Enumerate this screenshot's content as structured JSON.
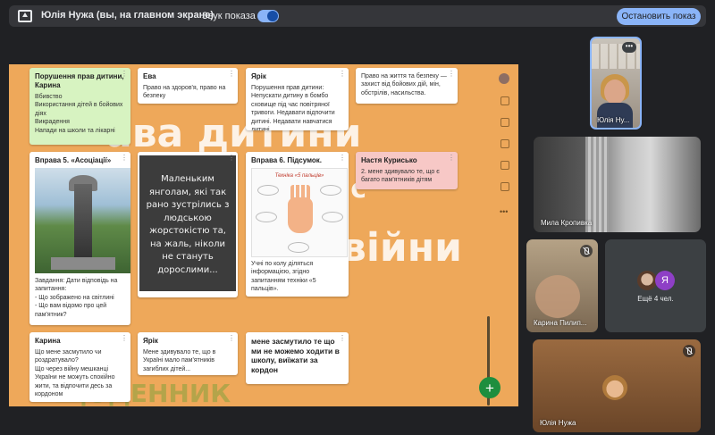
{
  "topbar": {
    "title": "Юлія Нужа (вы, на главном экране)",
    "sound_label": "Звук показа",
    "sound_on": true,
    "stop_button": "Остановить показ"
  },
  "presentation": {
    "bg_text_1": "ава дитини",
    "bg_text_2": "ас",
    "bg_text_3": "війни",
    "bg_text_4": "ЩОДЕННИК",
    "cards": {
      "c1": {
        "title": "Порушення прав дитини, Карина",
        "text": "Вбивство\nВикористання дітей в бойових діях\nВикрадення\nНапади на школи та лікарні"
      },
      "c2": {
        "title": "Ева",
        "text": "Право на здоров'я, право на безпеку"
      },
      "c3": {
        "title": "Ярік",
        "text": "Порушення прав дитини:\nНепускати дитину в бомбо сховище під час повітряної тривоги. Недавати відпочити дитині. Недавати навчатися дитині..."
      },
      "c4": {
        "text": "Право на життя та безпеку — захист від бойових дій, мін, обстрілів, насильства."
      },
      "c5": {
        "title": "Вправа 5. «Асоціації»",
        "text": "Завдання: Дати відповідь на запитання:\n-       Що зображено на світлині\n-       Що вам відомо  про цей пам'ятник?"
      },
      "c6": {
        "text": "Маленьким янголам, які так рано зустрілись з людською жорстокістю та, на жаль, ніколи не стануть дорослими..."
      },
      "c7": {
        "title": "Вправа 6. Підсумок.",
        "image_title": "Техніка «5 пальців»",
        "text": "Учні по колу діляться інформацією, згідно запитанням техніки «5 пальців»."
      },
      "c8": {
        "title": "Настя Курисько",
        "text": "2. мене здивувало те, що є багато пам'ятників дітям"
      },
      "c9": {
        "title": "Карина",
        "text": "Що мене засмутило чи роздратувало?\nЩо через війну мешканці України не можуть спокійно жити, та відпочити десь за кордоном"
      },
      "c10": {
        "title": "Ярік",
        "text": "Мене здивувало те, що в Україні мало пам'ятників загиблих дітей..."
      },
      "c11": {
        "title": "мене засмутило те що ми не можемо ходити в школу, виїжати за кордон"
      }
    },
    "fab_label": "+"
  },
  "participants": {
    "self_name": "Юлія Ну...",
    "mila": "Мила Кропивка",
    "karina": "Карина Пилип...",
    "more_initial": "Я",
    "more_count": "Ещё 4 чел.",
    "yulia": "Юлія Нужа"
  },
  "colors": {
    "background": "#202124",
    "topbar": "#35363a",
    "accent": "#8ab4f8",
    "presentation_bg": "#eea85a",
    "fab": "#1e8e3e",
    "avatar_purple": "#8e3fc6"
  }
}
